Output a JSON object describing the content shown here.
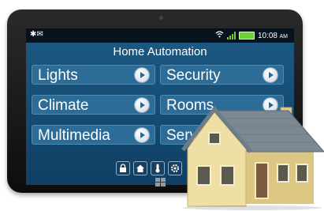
{
  "status_bar": {
    "left_icons": "✱✉",
    "time": "10:08",
    "time_suffix": "AM",
    "wifi_icon": "wifi-icon",
    "signal_icon": "signal-bars-icon",
    "battery_icon": "battery-icon",
    "battery_color": "#6ad12d"
  },
  "app": {
    "title": "Home Automation",
    "tiles": [
      {
        "label": "Lights"
      },
      {
        "label": "Security"
      },
      {
        "label": "Climate"
      },
      {
        "label": "Rooms"
      },
      {
        "label": "Multimedia"
      },
      {
        "label": "Servi"
      }
    ],
    "dock_icons": [
      "lock-icon",
      "house-icon",
      "thermometer-icon",
      "gear-icon"
    ]
  },
  "colors": {
    "screen_bg": "#1a5480",
    "tile_bg": "#2d6c96",
    "house_wall": "#e9d79a",
    "house_roof": "#7d8b96"
  }
}
